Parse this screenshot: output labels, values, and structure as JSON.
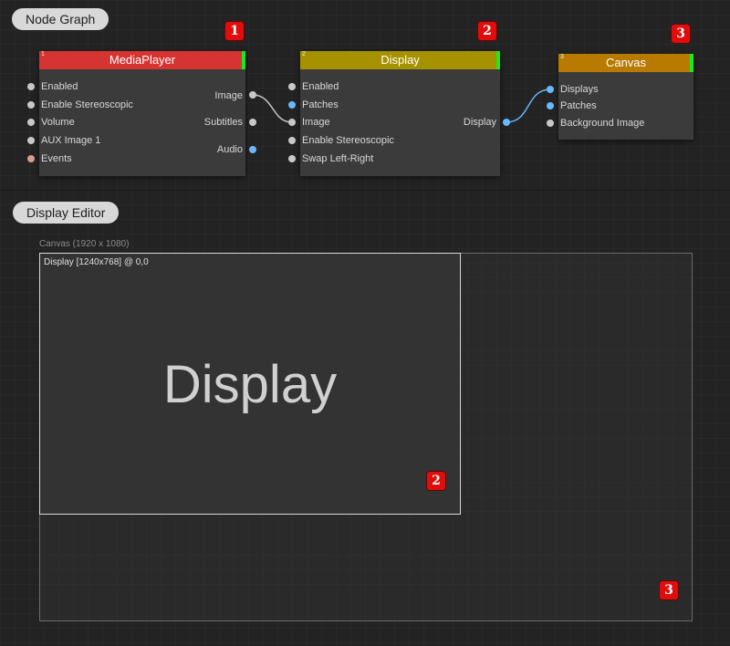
{
  "sections": {
    "node_graph": "Node Graph",
    "display_editor": "Display Editor"
  },
  "nodes": {
    "mediaplayer": {
      "index": "1",
      "title": "MediaPlayer",
      "header_color": "#d63333",
      "status_color": "#1ee81e",
      "marker": "1",
      "inputs": [
        "Enabled",
        "Enable Stereoscopic",
        "Volume",
        "AUX Image 1",
        "Events"
      ],
      "outputs": [
        "Image",
        "Subtitles",
        "Audio"
      ]
    },
    "display": {
      "index": "2",
      "title": "Display",
      "header_color": "#a69200",
      "status_color": "#1ee81e",
      "marker": "2",
      "inputs": [
        "Enabled",
        "Patches",
        "Image",
        "Enable Stereoscopic",
        "Swap Left-Right"
      ],
      "outputs": [
        "Display"
      ]
    },
    "canvas": {
      "index": "3",
      "title": "Canvas",
      "header_color": "#b87a00",
      "status_color": "#1ee81e",
      "marker": "3",
      "inputs": [
        "Displays",
        "Patches",
        "Background Image"
      ]
    }
  },
  "link_color": "#6ab7ff",
  "editor": {
    "canvas_label": "Canvas (1920 x 1080)",
    "display_label": "Display [1240x768] @ 0,0",
    "display_name": "Display",
    "display_marker": "2",
    "canvas_marker": "3"
  }
}
